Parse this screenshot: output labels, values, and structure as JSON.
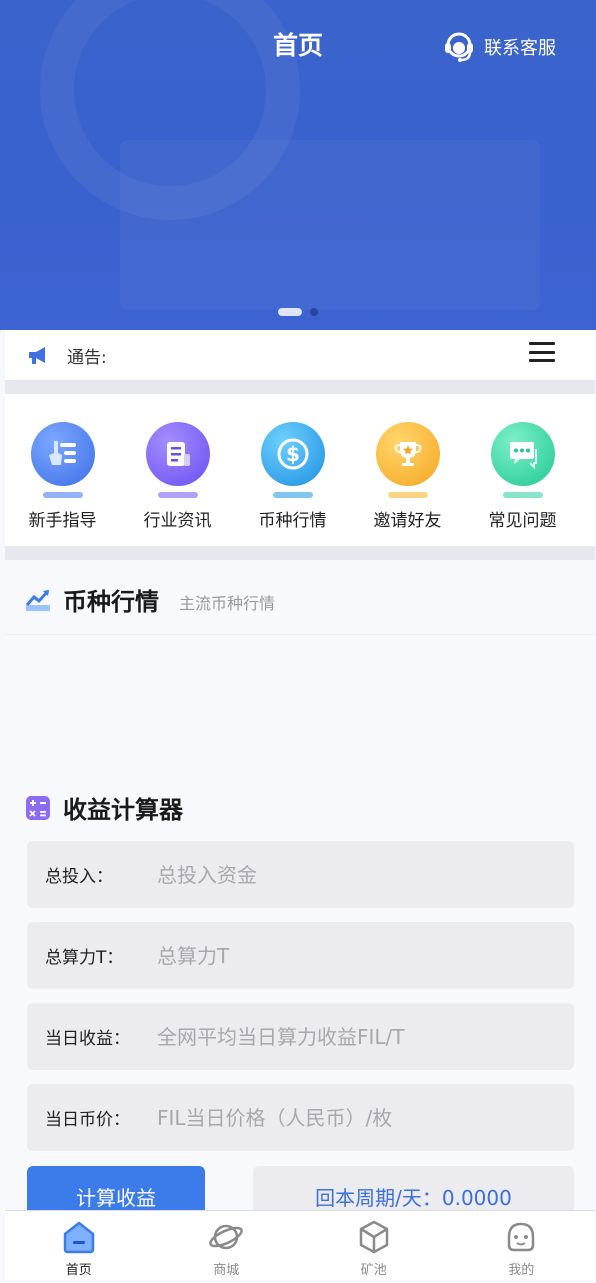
{
  "header": {
    "title": "首页",
    "service_label": "联系客服"
  },
  "notice": {
    "label": "通告:"
  },
  "quick_entries": [
    {
      "label": "新手指导",
      "icon": "guide-icon",
      "color": "#4a7fef"
    },
    {
      "label": "行业资讯",
      "icon": "news-icon",
      "color": "#7d63f3"
    },
    {
      "label": "币种行情",
      "icon": "dollar-coin-icon",
      "color": "#2ba0e8"
    },
    {
      "label": "邀请好友",
      "icon": "trophy-icon",
      "color": "#f5b731"
    },
    {
      "label": "常见问题",
      "icon": "chat-icon",
      "color": "#36d3a6"
    }
  ],
  "market": {
    "title": "币种行情",
    "subtitle": "主流币种行情"
  },
  "calculator": {
    "title": "收益计算器",
    "fields": [
      {
        "label": "总投入：",
        "placeholder": "总投入资金"
      },
      {
        "label": "总算力T：",
        "placeholder": "总算力T"
      },
      {
        "label": "当日收益：",
        "placeholder": "全网平均当日算力收益FIL/T"
      },
      {
        "label": "当日币价：",
        "placeholder": "FIL当日价格（人民币）/枚"
      }
    ],
    "button_label": "计算收益",
    "result_text": "回本周期/天：0.0000"
  },
  "tabbar": [
    {
      "label": "首页",
      "icon": "home-icon",
      "active": true
    },
    {
      "label": "商城",
      "icon": "planet-icon",
      "active": false
    },
    {
      "label": "矿池",
      "icon": "cube-icon",
      "active": false
    },
    {
      "label": "我的",
      "icon": "user-face-icon",
      "active": false
    }
  ],
  "colors": {
    "primary": "#3b7bea",
    "banner": "#3a63cc",
    "result_text": "#3b6fdc"
  }
}
